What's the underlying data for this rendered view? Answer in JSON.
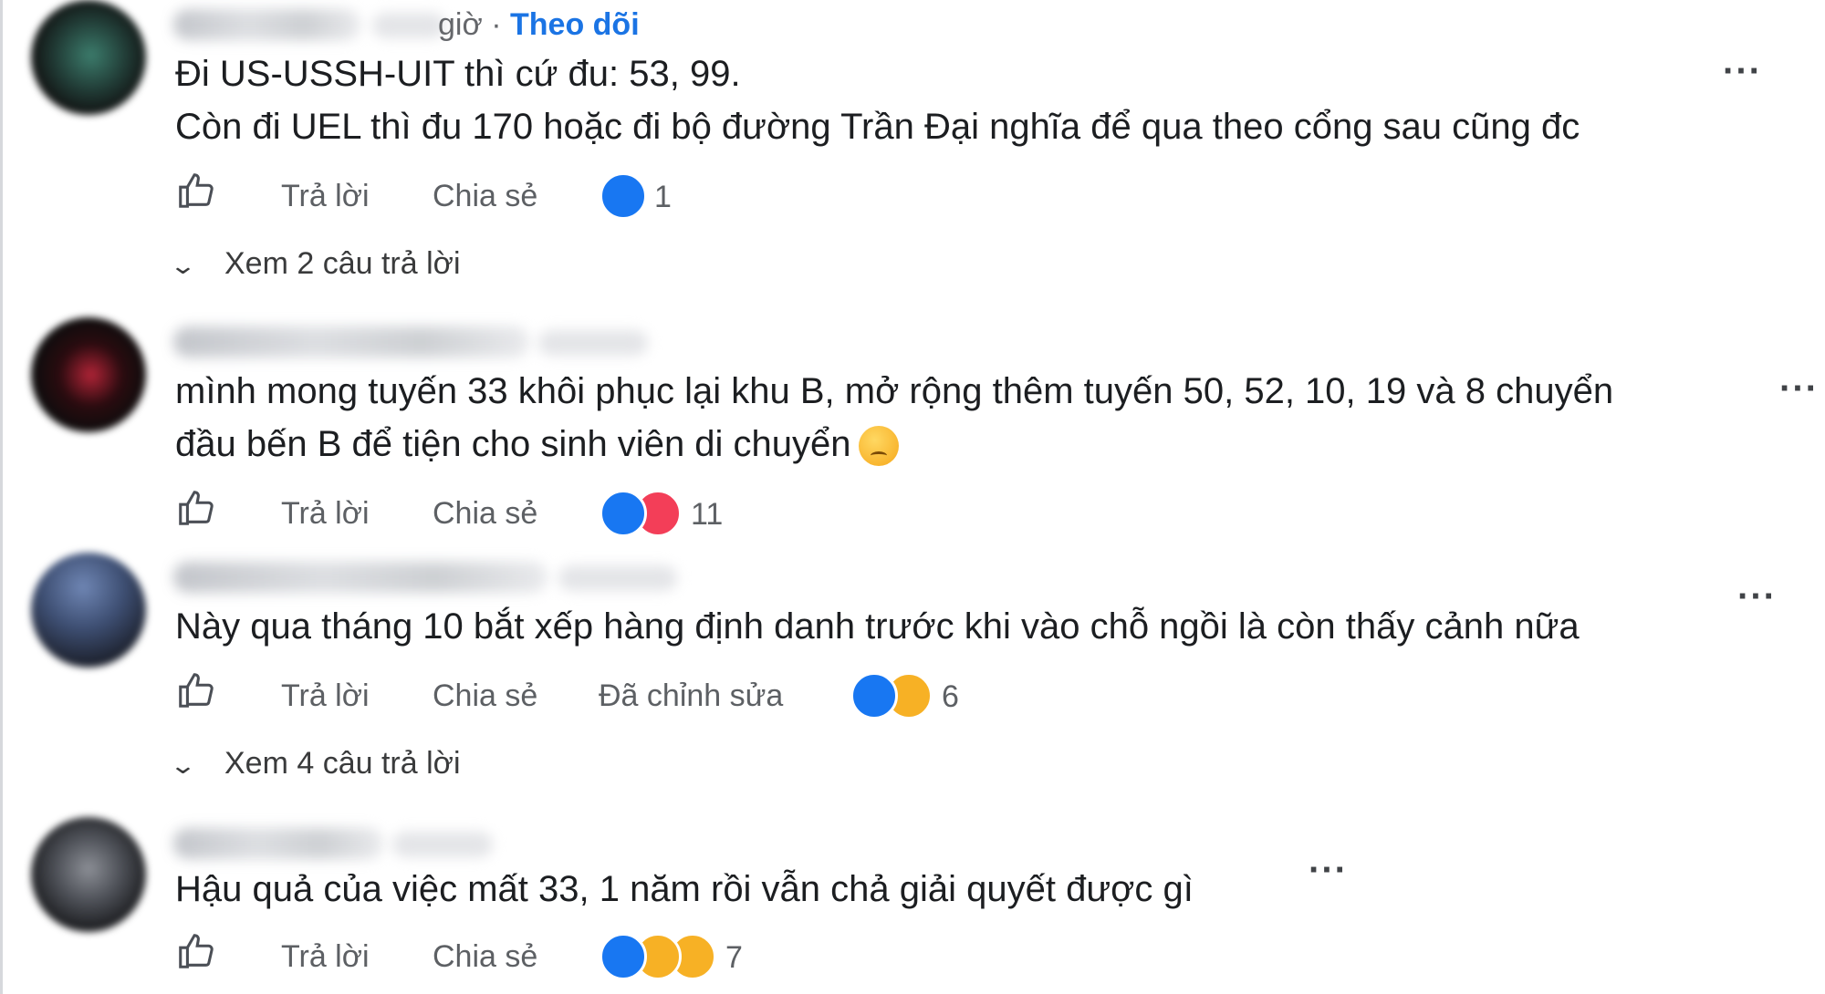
{
  "comments": [
    {
      "time_suffix": "giờ",
      "separator": "·",
      "follow_label": "Theo dõi",
      "lines": [
        "Đi US-USSH-UIT thì cứ đu: 53, 99.",
        "Còn đi UEL thì đu 170 hoặc đi bộ đường Trần Đại nghĩa để qua theo cổng sau cũng đc"
      ],
      "reply_label": "Trả lời",
      "share_label": "Chia sẻ",
      "reactions": [
        "like"
      ],
      "reaction_count": "1",
      "view_replies": "Xem 2 câu trả lời",
      "more_icon": "more-dots-icon",
      "avatar_color": "#2b4a42"
    },
    {
      "lines": [
        "mình mong tuyến 33 khôi phục lại khu B, mở rộng thêm tuyến 50, 52, 10, 19 và 8 chuyển",
        "đầu bến B để tiện cho sinh viên di chuyển"
      ],
      "trailing_emoji": "sad-face-emoji",
      "reply_label": "Trả lời",
      "share_label": "Chia sẻ",
      "reactions": [
        "like",
        "love"
      ],
      "reaction_count": "11",
      "more_icon": "more-dots-icon",
      "avatar_color": "#4a1a1e"
    },
    {
      "lines": [
        "Này qua tháng 10 bắt xếp hàng định danh trước khi vào chỗ ngồi là còn thấy cảnh nữa"
      ],
      "reply_label": "Trả lời",
      "share_label": "Chia sẻ",
      "edited_label": "Đã chỉnh sửa",
      "reactions": [
        "like",
        "haha"
      ],
      "reaction_count": "6",
      "view_replies": "Xem 4 câu trả lời",
      "more_icon": "more-dots-icon",
      "avatar_color": "#3e4a66"
    },
    {
      "lines": [
        "Hậu quả của việc mất 33, 1 năm rồi vẫn chả giải quyết được gì"
      ],
      "reply_label": "Trả lời",
      "share_label": "Chia sẻ",
      "reactions": [
        "like",
        "haha",
        "sad"
      ],
      "reaction_count": "7",
      "more_icon": "more-dots-icon",
      "avatar_color": "#4a4c52"
    }
  ],
  "colors": {
    "link_blue": "#1b74e4",
    "text": "#1c1e21",
    "secondary": "#65676b",
    "like": "#1877f2",
    "love": "#f33e58",
    "haha": "#f7b125"
  }
}
